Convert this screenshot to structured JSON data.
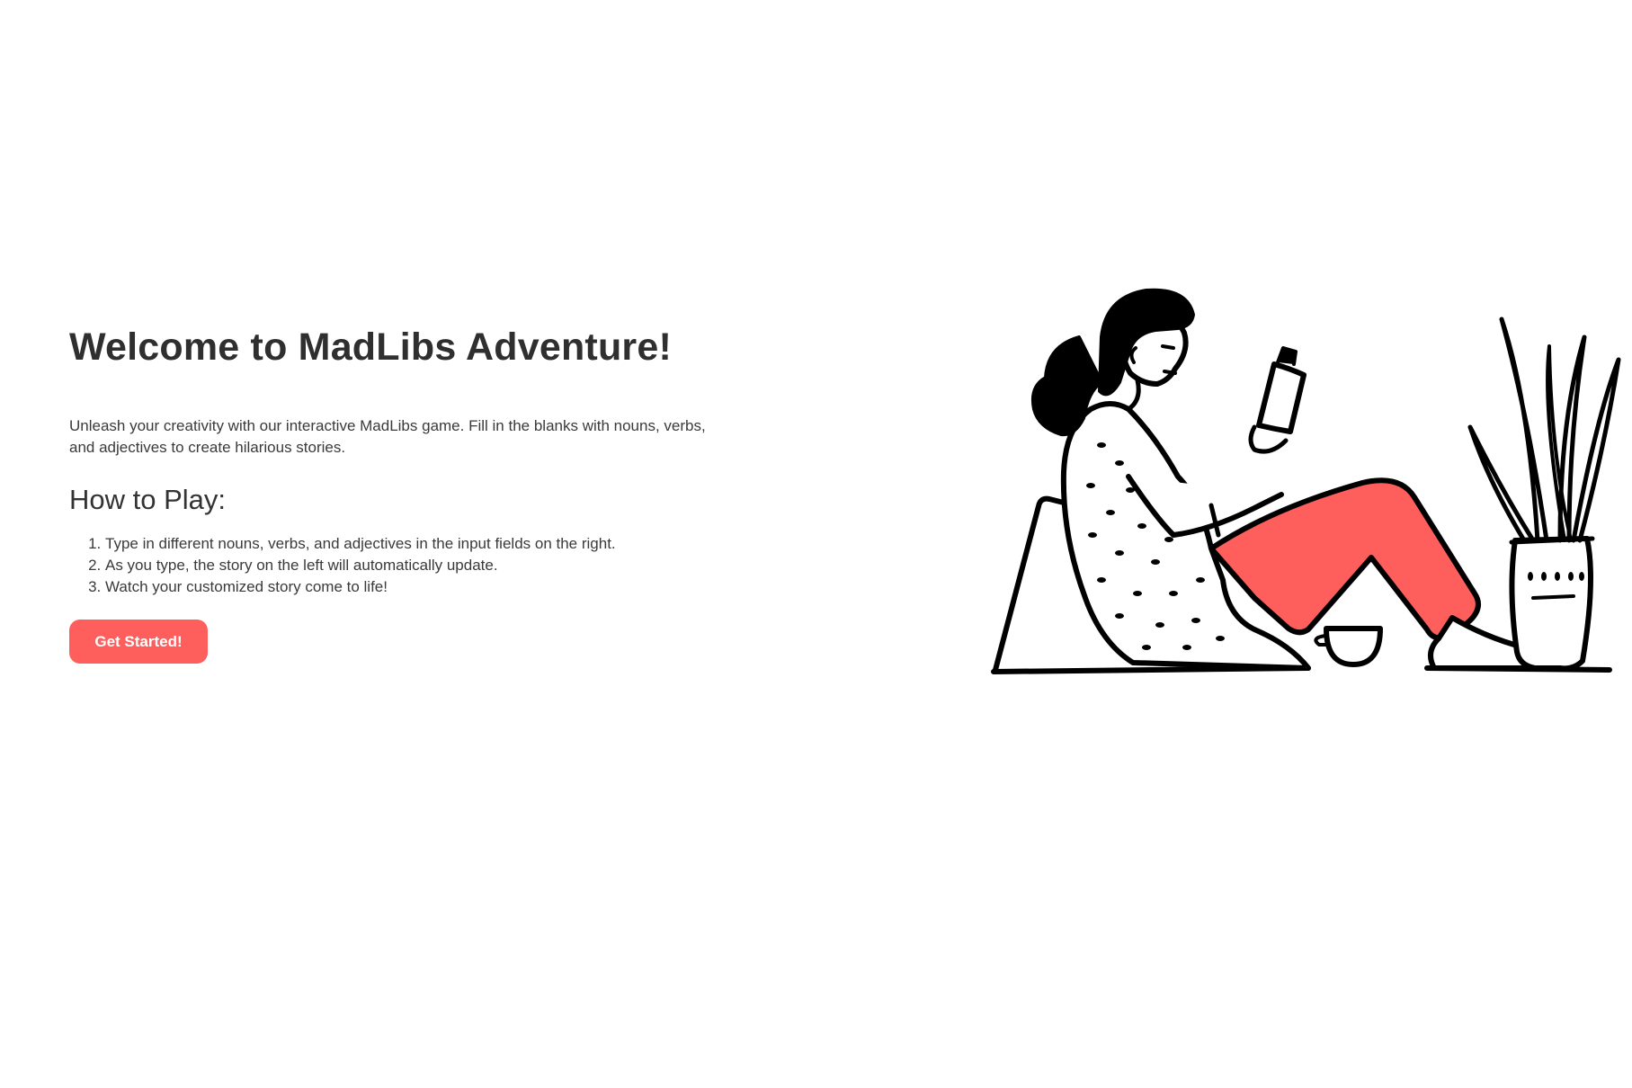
{
  "hero": {
    "title": "Welcome to MadLibs Adventure!",
    "intro": "Unleash your creativity with our interactive MadLibs game. Fill in the blanks with nouns, verbs, and adjectives to create hilarious stories.",
    "how_to_play_title": "How to Play:",
    "steps": [
      "Type in different nouns, verbs, and adjectives in the input fields on the right.",
      "As you type, the story on the left will automatically update.",
      "Watch your customized story come to life!"
    ],
    "cta_label": "Get Started!"
  },
  "illustration": {
    "icon": "woman-reading-illustration",
    "accent_color": "#fe5f5c",
    "line_color": "#000000"
  }
}
